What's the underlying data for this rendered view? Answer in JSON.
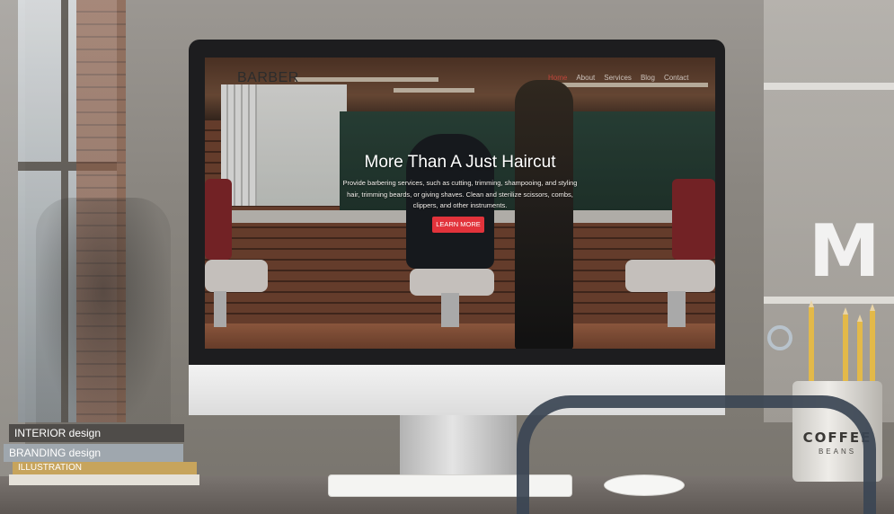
{
  "website": {
    "logo": "BARBER",
    "nav": [
      {
        "label": "Home",
        "active": true
      },
      {
        "label": "About",
        "active": false
      },
      {
        "label": "Services",
        "active": false
      },
      {
        "label": "Blog",
        "active": false
      },
      {
        "label": "Contact",
        "active": false
      }
    ],
    "hero": {
      "title": "More Than A Just Haircut",
      "description": "Provide barbering services, such as cutting, trimming, shampooing, and styling hair, trimming beards, or giving shaves. Clean and sterilize scissors, combs, clippers, and other instruments.",
      "cta_label": "LEARN MORE"
    },
    "accent_color": "#e2333b"
  },
  "books": [
    {
      "label": "INTERIOR design"
    },
    {
      "label": "BRANDING design"
    },
    {
      "label": "ILLUSTRATION"
    }
  ],
  "cup": {
    "brand": "COFFEE",
    "sub": "BEANS"
  },
  "decor": {
    "wall_letter": "M"
  }
}
